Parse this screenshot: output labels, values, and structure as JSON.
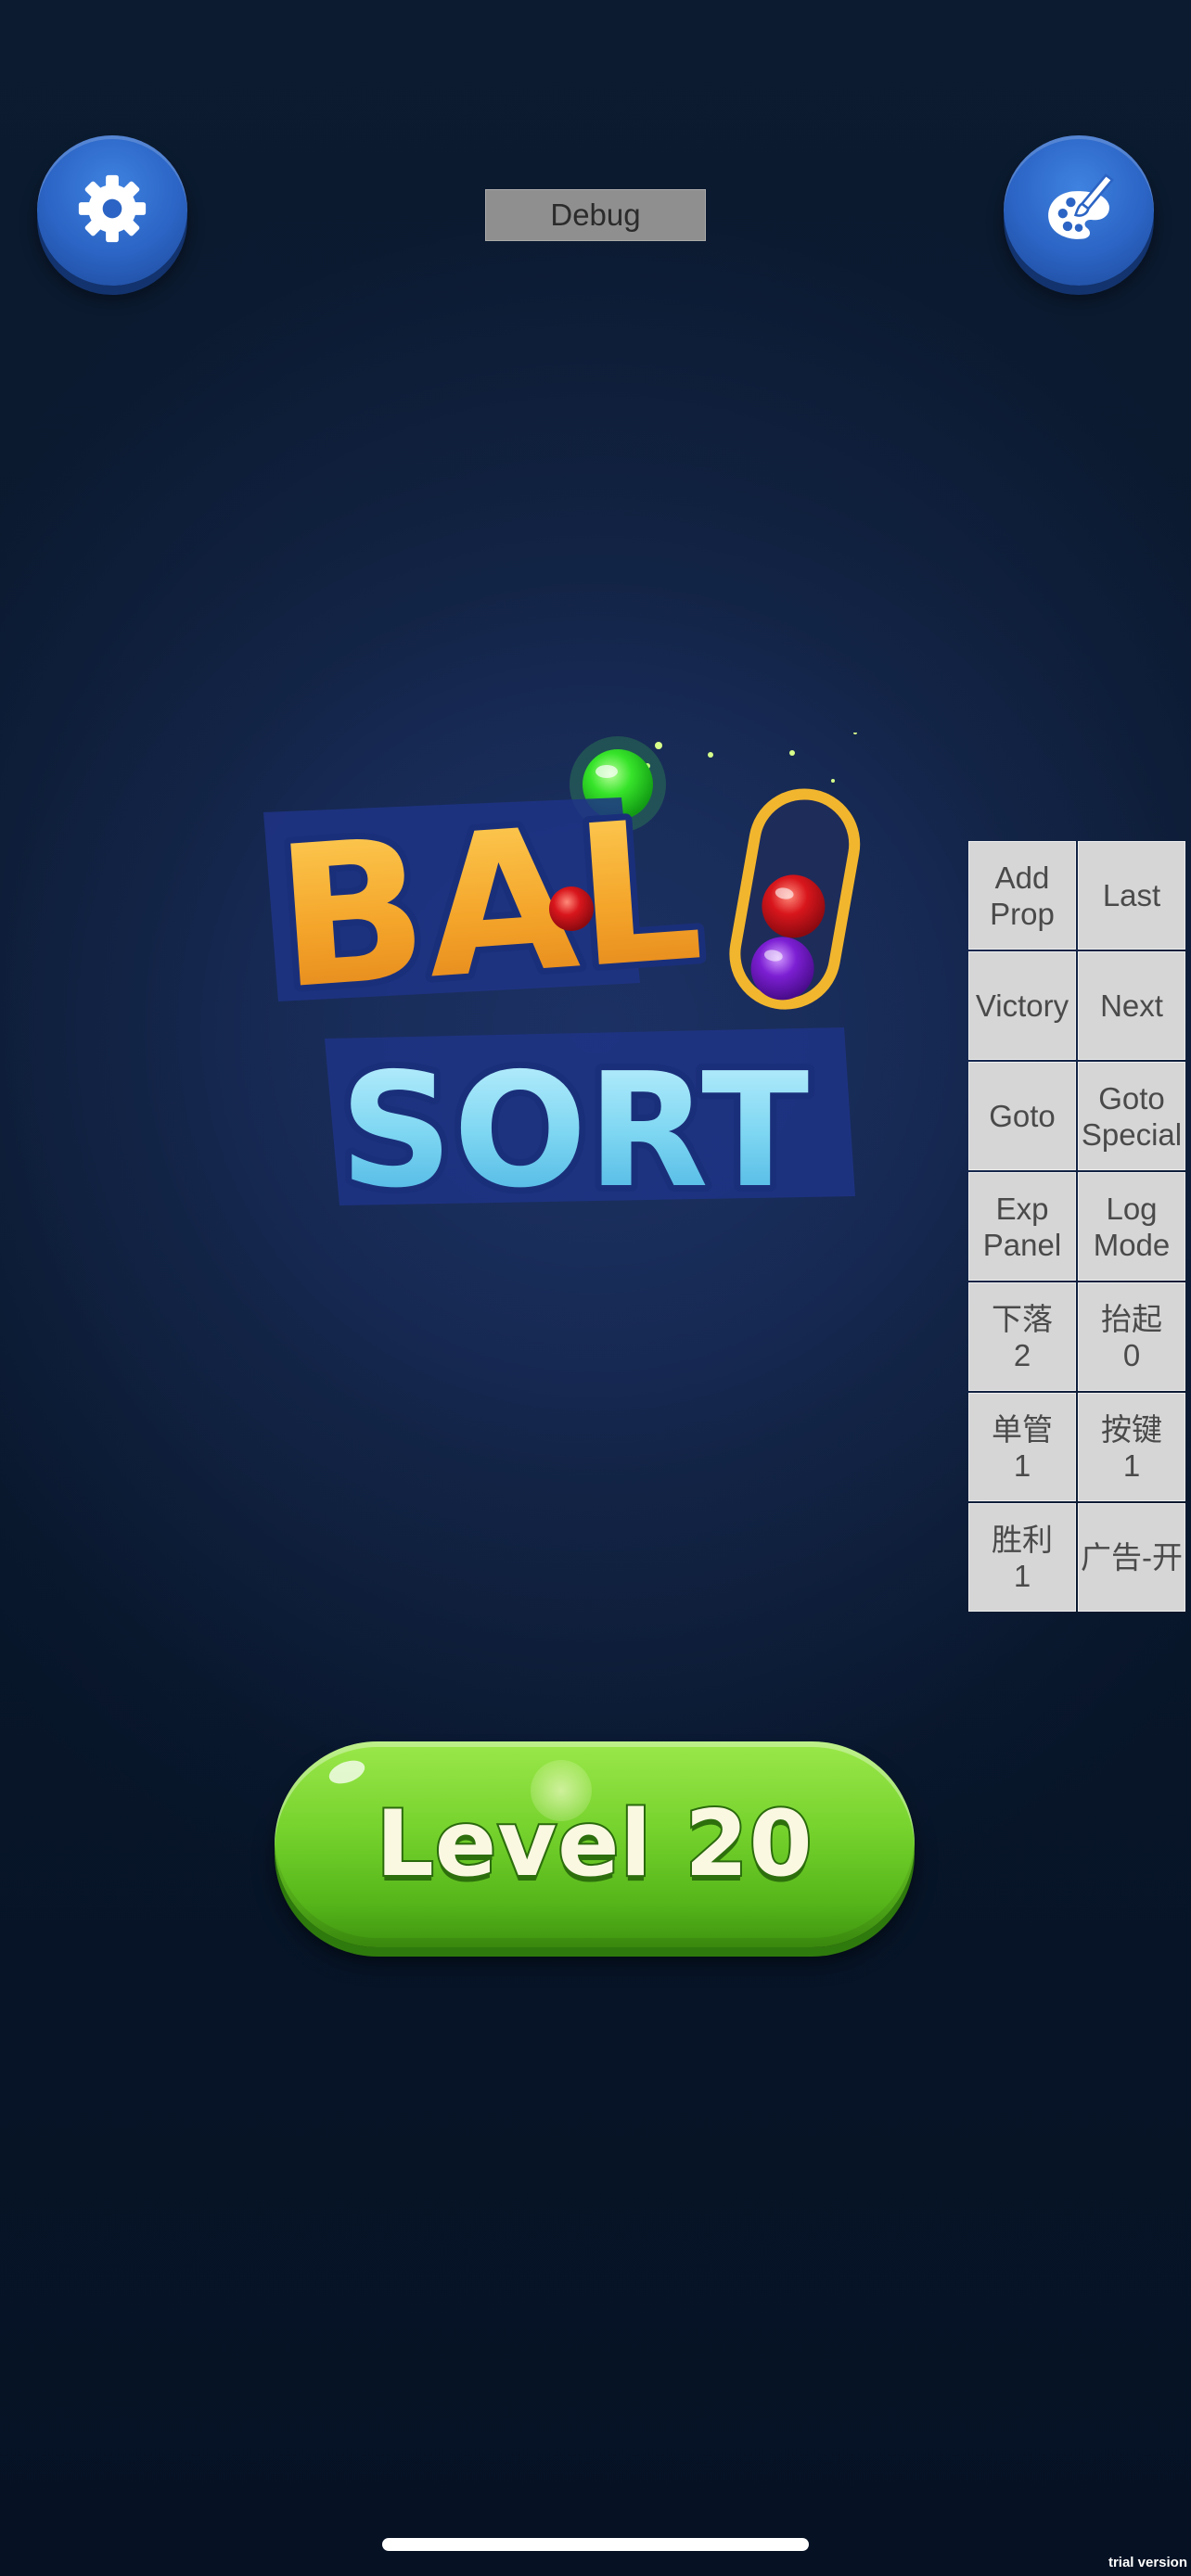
{
  "toolbar": {
    "settings_icon": "gear-icon",
    "theme_icon": "palette-brush-icon",
    "debug_label": "Debug"
  },
  "logo": {
    "line1": "BAL",
    "line2": "SORT",
    "colors": {
      "ball_green": "#37e42a",
      "ball_red": "#d8161c",
      "ball_purple": "#7c1fd3",
      "title_orange": "#f2a52c",
      "title_blue": "#7fd7f2"
    }
  },
  "debug_panel": {
    "buttons": [
      {
        "label": "Add\nProp"
      },
      {
        "label": "Last"
      },
      {
        "label": "Victory"
      },
      {
        "label": "Next"
      },
      {
        "label": "Goto"
      },
      {
        "label": "Goto\nSpecial"
      },
      {
        "label": "Exp\nPanel"
      },
      {
        "label": "Log\nMode"
      },
      {
        "label": "下落\n2"
      },
      {
        "label": "抬起\n0"
      },
      {
        "label": "单管\n1"
      },
      {
        "label": "按键\n1"
      },
      {
        "label": "胜利\n1"
      },
      {
        "label": "广告-开"
      }
    ]
  },
  "level_button": {
    "label": "Level 20",
    "color": "#74d12c"
  },
  "footer": {
    "watermark": "trial version"
  }
}
